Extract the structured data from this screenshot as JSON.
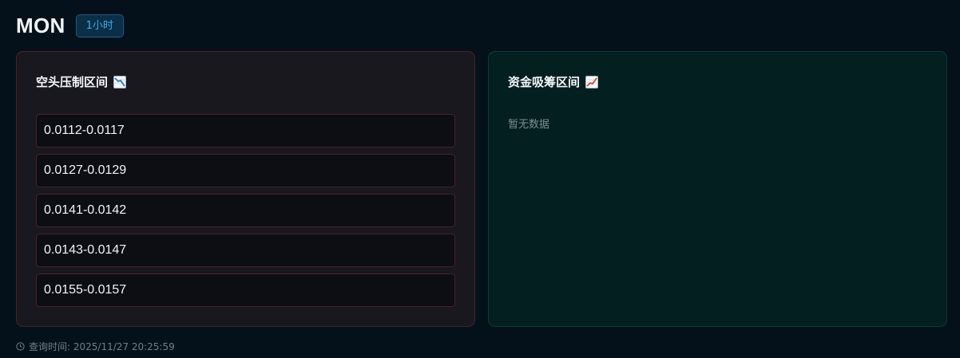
{
  "header": {
    "symbol": "MON",
    "timeframe": "1小时"
  },
  "short_zone": {
    "title": "空头压制区间",
    "icon": "chart-decreasing-icon",
    "ranges": [
      "0.0112-0.0117",
      "0.0127-0.0129",
      "0.0141-0.0142",
      "0.0143-0.0147",
      "0.0155-0.0157"
    ]
  },
  "accum_zone": {
    "title": "资金吸筹区间",
    "icon": "chart-increasing-icon",
    "empty_text": "暂无数据"
  },
  "footer": {
    "query_time": "查询时间: 2025/11/27 20:25:59",
    "icon": "clock-icon"
  },
  "colors": {
    "background": "#04111a",
    "short_panel_border": "#4a2029",
    "accum_panel_bg": "#031f20",
    "timeframe_accent": "#3fa9ee"
  }
}
